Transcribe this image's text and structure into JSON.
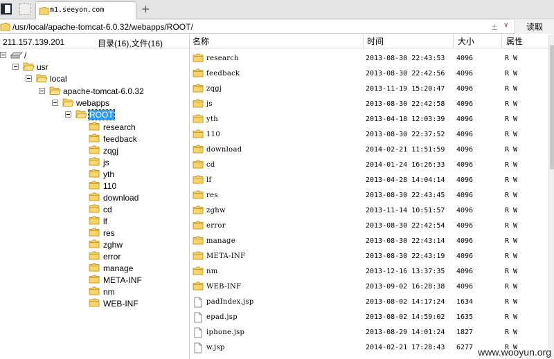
{
  "tab": {
    "title": "m1.seeyon.com",
    "new_tab_symbol": "+"
  },
  "address": {
    "path": "/usr/local/apache-tomcat-6.0.32/webapps/ROOT/",
    "pm_symbol": "± ",
    "dropdown_symbol": "∨",
    "read_button": "读取"
  },
  "status": {
    "ip": "211.157.139.201",
    "count": "目录(16),文件(16)"
  },
  "columns": {
    "name": "名称",
    "time": "时间",
    "size": "大小",
    "attr": "属性"
  },
  "tree": {
    "root": "/",
    "usr": "usr",
    "local": "local",
    "tomcat": "apache-tomcat-6.0.32",
    "webapps": "webapps",
    "root_dir": "ROOT",
    "children": [
      "research",
      "feedback",
      "zqgj",
      "js",
      "yth",
      "110",
      "download",
      "cd",
      "lf",
      "res",
      "zghw",
      "error",
      "manage",
      "META-INF",
      "nm",
      "WEB-INF"
    ]
  },
  "files": [
    {
      "name": "research",
      "time": "2013-08-30 22:43:53",
      "size": "4096",
      "attr": "R W",
      "type": "folder"
    },
    {
      "name": "feedback",
      "time": "2013-08-30 22:42:56",
      "size": "4096",
      "attr": "R W",
      "type": "folder"
    },
    {
      "name": "zqgj",
      "time": "2013-11-19 15:20:47",
      "size": "4096",
      "attr": "R W",
      "type": "folder"
    },
    {
      "name": "js",
      "time": "2013-08-30 22:42:58",
      "size": "4096",
      "attr": "R W",
      "type": "folder"
    },
    {
      "name": "yth",
      "time": "2013-04-18 12:03:39",
      "size": "4096",
      "attr": "R W",
      "type": "folder"
    },
    {
      "name": "110",
      "time": "2013-08-30 22:37:52",
      "size": "4096",
      "attr": "R W",
      "type": "folder"
    },
    {
      "name": "download",
      "time": "2014-02-21 11:51:59",
      "size": "4096",
      "attr": "R W",
      "type": "folder"
    },
    {
      "name": "cd",
      "time": "2014-01-24 16:26:33",
      "size": "4096",
      "attr": "R W",
      "type": "folder"
    },
    {
      "name": "lf",
      "time": "2013-04-28 14:04:14",
      "size": "4096",
      "attr": "R W",
      "type": "folder"
    },
    {
      "name": "res",
      "time": "2013-08-30 22:43:45",
      "size": "4096",
      "attr": "R W",
      "type": "folder"
    },
    {
      "name": "zghw",
      "time": "2013-11-14 10:51:57",
      "size": "4096",
      "attr": "R W",
      "type": "folder"
    },
    {
      "name": "error",
      "time": "2013-08-30 22:42:54",
      "size": "4096",
      "attr": "R W",
      "type": "folder"
    },
    {
      "name": "manage",
      "time": "2013-08-30 22:43:14",
      "size": "4096",
      "attr": "R W",
      "type": "folder"
    },
    {
      "name": "META-INF",
      "time": "2013-08-30 22:43:19",
      "size": "4096",
      "attr": "R W",
      "type": "folder"
    },
    {
      "name": "nm",
      "time": "2013-12-16 13:37:35",
      "size": "4096",
      "attr": "R W",
      "type": "folder"
    },
    {
      "name": "WEB-INF",
      "time": "2013-09-02 16:28:38",
      "size": "4096",
      "attr": "R W",
      "type": "folder"
    },
    {
      "name": "padIndex.jsp",
      "time": "2013-08-02 14:17:24",
      "size": "1634",
      "attr": "R W",
      "type": "file"
    },
    {
      "name": "epad.jsp",
      "time": "2013-08-02 14:59:02",
      "size": "1635",
      "attr": "R W",
      "type": "file"
    },
    {
      "name": "iphone.jsp",
      "time": "2013-08-29 14:01:24",
      "size": "1827",
      "attr": "R W",
      "type": "file"
    },
    {
      "name": "w.jsp",
      "time": "2014-02-21 17:28:43",
      "size": "6277",
      "attr": "R W",
      "type": "file"
    }
  ],
  "watermark": "www.wooyun.org",
  "colors": {
    "folder_fill": "#f7d56b",
    "folder_stroke": "#c89a2a",
    "selection": "#3399ff"
  }
}
